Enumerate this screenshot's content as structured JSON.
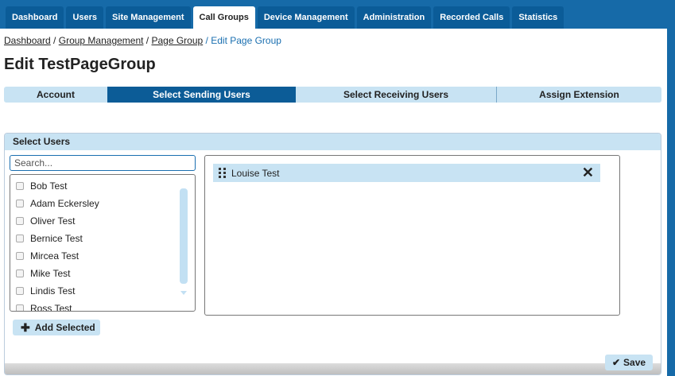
{
  "nav": {
    "tabs": [
      {
        "label": "Dashboard"
      },
      {
        "label": "Users"
      },
      {
        "label": "Site Management"
      },
      {
        "label": "Call Groups"
      },
      {
        "label": "Device Management"
      },
      {
        "label": "Administration"
      },
      {
        "label": "Recorded Calls"
      },
      {
        "label": "Statistics"
      }
    ],
    "active": "Call Groups"
  },
  "breadcrumb": {
    "items": [
      "Dashboard",
      "Group Management",
      "Page Group"
    ],
    "separator": " / ",
    "current": "Edit Page Group"
  },
  "page_title": "Edit TestPageGroup",
  "wizard": {
    "steps": [
      {
        "label": "Account"
      },
      {
        "label": "Select Sending Users"
      },
      {
        "label": "Select Receiving Users"
      },
      {
        "label": "Assign Extension"
      }
    ],
    "active": "Select Sending Users"
  },
  "select_users": {
    "header": "Select Users",
    "search_placeholder": "Search...",
    "users": [
      "Bob Test",
      "Adam Eckersley",
      "Oliver Test",
      "Bernice Test",
      "Mircea Test",
      "Mike Test",
      "Lindis Test",
      "Ross Test"
    ],
    "add_label": "Add Selected"
  },
  "selected_users": [
    {
      "name": "Louise Test"
    }
  ],
  "save_label": "Save",
  "colors": {
    "nav_bg": "#166aa8",
    "tab_bg": "#0b5c98",
    "light_blue": "#c8e3f3",
    "active_step": "#0c5c97"
  },
  "icons": {
    "add": "plus-icon",
    "save": "checkmark-icon",
    "remove": "close-icon",
    "drag": "drag-handle-icon"
  }
}
